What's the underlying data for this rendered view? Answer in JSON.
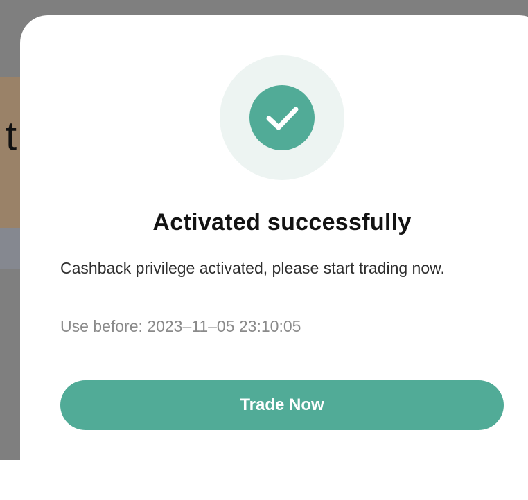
{
  "background": {
    "partial_text": "t"
  },
  "dialog": {
    "icon": "check-circle-icon",
    "title": "Activated successfully",
    "message": "Cashback privilege activated, please start trading now.",
    "expiry": "Use before: 2023–11–05 23:10:05",
    "button_label": "Trade Now"
  },
  "colors": {
    "accent": "#51ab97",
    "icon_halo": "#edf4f2",
    "overlay": "#7f7f7f"
  }
}
